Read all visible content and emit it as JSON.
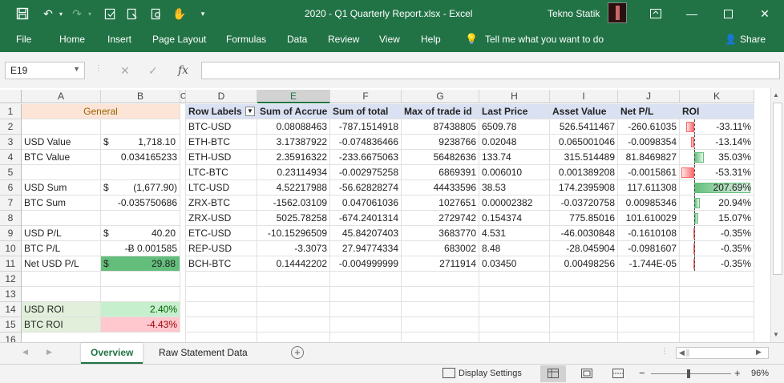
{
  "window": {
    "title": "2020 - Q1 Quarterly Report.xlsx  -  Excel",
    "user": "Tekno Statik"
  },
  "ribbon_tabs": [
    "File",
    "Home",
    "Insert",
    "Page Layout",
    "Formulas",
    "Data",
    "Review",
    "View",
    "Help"
  ],
  "tell_me": "Tell me what you want to do",
  "share": "Share",
  "name_box": "E19",
  "fx_label": "fx",
  "columns": [
    "A",
    "B",
    "C",
    "D",
    "E",
    "F",
    "G",
    "H",
    "I",
    "J",
    "K"
  ],
  "rows": [
    "1",
    "2",
    "3",
    "4",
    "5",
    "6",
    "7",
    "8",
    "9",
    "10",
    "11",
    "12",
    "13",
    "14",
    "15",
    "16"
  ],
  "left_panel": {
    "header": "General",
    "usd_value_label": "USD Value",
    "usd_value_cur": "$",
    "usd_value": "1,718.10",
    "btc_value_label": "BTC Value",
    "btc_value": "0.034165233",
    "usd_sum_label": "USD Sum",
    "usd_sum_cur": "$",
    "usd_sum": "(1,677.90)",
    "btc_sum_label": "BTC Sum",
    "btc_sum": "-0.035750686",
    "usd_pl_label": "USD P/L",
    "usd_pl_cur": "$",
    "usd_pl": "40.20",
    "btc_pl_label": "BTC P/L",
    "btc_pl": "-Ƀ 0.001585",
    "net_usd_pl_label": "Net USD P/L",
    "net_usd_pl_cur": "$",
    "net_usd_pl": "29.88",
    "usd_roi_label": "USD ROI",
    "usd_roi": "2.40%",
    "btc_roi_label": "BTC ROI",
    "btc_roi": "-4.43%"
  },
  "pivot": {
    "headers": [
      "Row Labels",
      "Sum of Accrue",
      "Sum of total",
      "Max of trade id",
      "Last Price",
      "Asset Value",
      "Net P/L",
      "ROI"
    ],
    "rows": [
      {
        "label": "BTC-USD",
        "accrue": "0.08088463",
        "total": "-787.1514918",
        "trade_id": "87438805",
        "price": "6509.78",
        "asset": "526.5411467",
        "netpl": "-260.61035",
        "roi": "-33.11%",
        "roi_value": -33.11
      },
      {
        "label": "ETH-BTC",
        "accrue": "3.17387922",
        "total": "-0.074836466",
        "trade_id": "9238766",
        "price": "0.02048",
        "asset": "0.065001046",
        "netpl": "-0.0098354",
        "roi": "-13.14%",
        "roi_value": -13.14
      },
      {
        "label": "ETH-USD",
        "accrue": "2.35916322",
        "total": "-233.6675063",
        "trade_id": "56482636",
        "price": "133.74",
        "asset": "315.514489",
        "netpl": "81.8469827",
        "roi": "35.03%",
        "roi_value": 35.03
      },
      {
        "label": "LTC-BTC",
        "accrue": "0.23114934",
        "total": "-0.002975258",
        "trade_id": "6869391",
        "price": "0.006010",
        "asset": "0.001389208",
        "netpl": "-0.0015861",
        "roi": "-53.31%",
        "roi_value": -53.31
      },
      {
        "label": "LTC-USD",
        "accrue": "4.52217988",
        "total": "-56.62828274",
        "trade_id": "44433596",
        "price": "38.53",
        "asset": "174.2395908",
        "netpl": "117.611308",
        "roi": "207.69%",
        "roi_value": 207.69
      },
      {
        "label": "ZRX-BTC",
        "accrue": "-1562.03109",
        "total": "0.047061036",
        "trade_id": "1027651",
        "price": "0.00002382",
        "asset": "-0.03720758",
        "netpl": "0.00985346",
        "roi": "20.94%",
        "roi_value": 20.94
      },
      {
        "label": "ZRX-USD",
        "accrue": "5025.78258",
        "total": "-674.2401314",
        "trade_id": "2729742",
        "price": "0.154374",
        "asset": "775.85016",
        "netpl": "101.610029",
        "roi": "15.07%",
        "roi_value": 15.07
      },
      {
        "label": "ETC-USD",
        "accrue": "-10.15296509",
        "total": "45.84207403",
        "trade_id": "3683770",
        "price": "4.531",
        "asset": "-46.0030848",
        "netpl": "-0.1610108",
        "roi": "-0.35%",
        "roi_value": -0.35
      },
      {
        "label": "REP-USD",
        "accrue": "-3.3073",
        "total": "27.94774334",
        "trade_id": "683002",
        "price": "8.48",
        "asset": "-28.045904",
        "netpl": "-0.0981607",
        "roi": "-0.35%",
        "roi_value": -0.35
      },
      {
        "label": "BCH-BTC",
        "accrue": "0.14442202",
        "total": "-0.004999999",
        "trade_id": "2711914",
        "price": "0.03450",
        "asset": "0.00498256",
        "netpl": "-1.744E-05",
        "roi": "-0.35%",
        "roi_value": -0.35
      }
    ]
  },
  "sheets": [
    "Overview",
    "Raw Statement Data"
  ],
  "status": {
    "display_settings": "Display Settings",
    "zoom": "96%"
  },
  "colors": {
    "excel_green": "#217346",
    "pivot_header": "#d9e1f2",
    "positive": "#63be7b",
    "negative": "#f8696b"
  }
}
